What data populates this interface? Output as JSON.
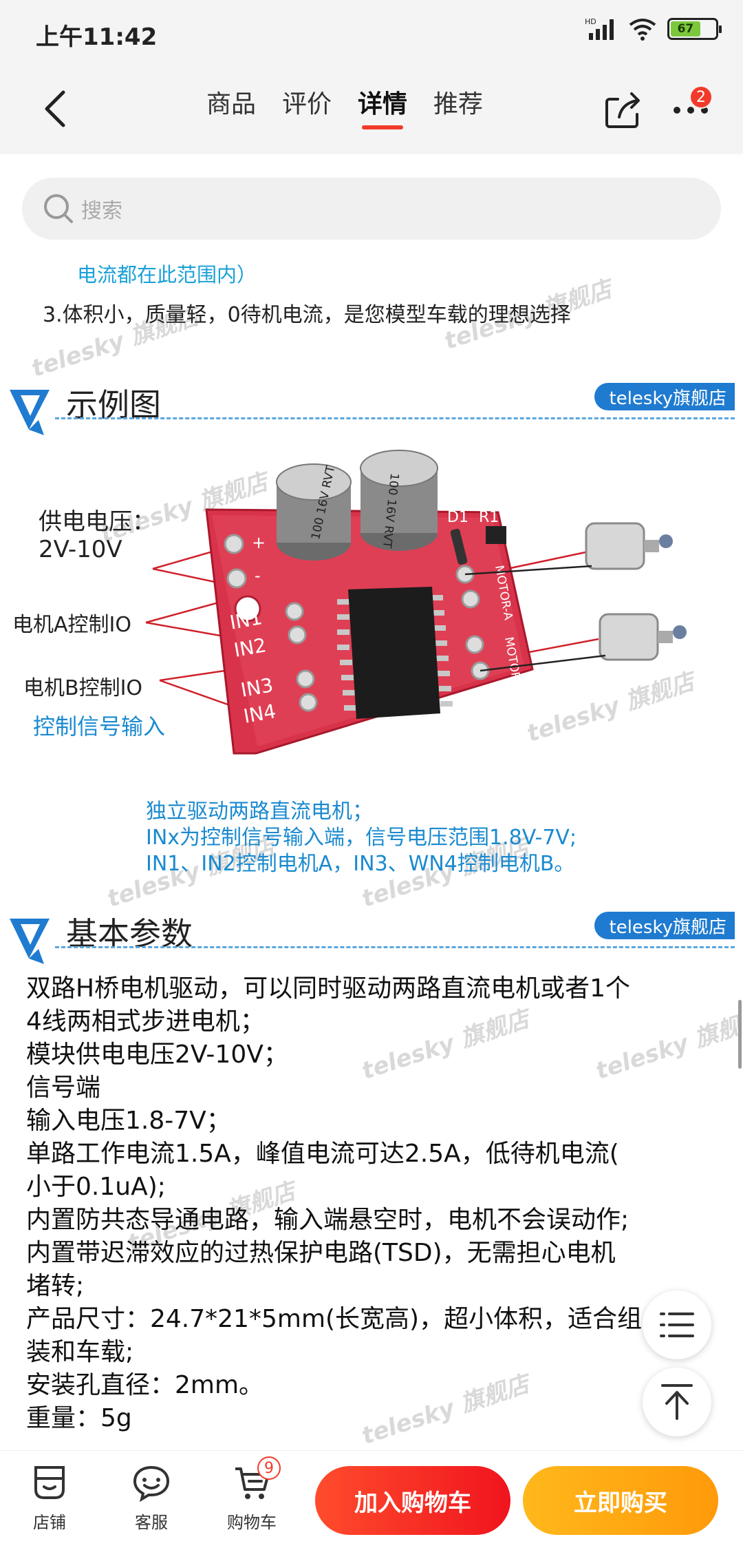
{
  "status_bar": {
    "time": "上午11:42",
    "network": "HD",
    "battery": "67"
  },
  "nav": {
    "tabs": [
      "商品",
      "评价",
      "详情",
      "推荐"
    ],
    "active_tab": "详情",
    "more_badge": "2"
  },
  "search": {
    "placeholder": "搜索"
  },
  "detail": {
    "intro_tail": "电流都在此范围内）",
    "feature_3": "3.体积小，质量轻，0待机电流，是您模型车载的理想选择",
    "watermark": "telesky 旗舰店",
    "section_example": {
      "title": "示例图",
      "brand_tag": "telesky旗舰店"
    },
    "pcb_labels": {
      "power_label": "供电电压：",
      "power_range": "2V-10V",
      "motor_a_io": "电机A控制IO",
      "motor_b_io": "电机B控制IO",
      "signal_input": "控制信号输入"
    },
    "pcb_silkscreen": {
      "cap1": "100 16V RVT",
      "cap2": "100 16V RVT",
      "d1": "D1",
      "r1": "R1",
      "in1": "IN1",
      "in2": "IN2",
      "in3": "IN3",
      "in4": "IN4",
      "motor_a": "MOTOR-A",
      "motor_b": "MOTOR-B",
      "plus": "+",
      "minus": "-"
    },
    "desc_lines": [
      "独立驱动两路直流电机；",
      "INx为控制信号输入端，信号电压范围1.8V-7V;",
      "IN1、IN2控制电机A，IN3、WN4控制电机B。"
    ],
    "section_params": {
      "title": "基本参数",
      "brand_tag": "telesky旗舰店"
    },
    "params_lines": [
      "双路H桥电机驱动，可以同时驱动两路直流电机或者1个",
      "4线两相式步进电机；",
      "模块供电电压2V-10V；",
      "信号端",
      "输入电压1.8-7V；",
      "单路工作电流1.5A，峰值电流可达2.5A，低待机电流(",
      "小于0.1uA);",
      "内置防共态导通电路，输入端悬空时，电机不会误动作;",
      "内置带迟滞效应的过热保护电路(TSD)，无需担心电机",
      "堵转;",
      "产品尺寸：24.7*21*5mm(长宽高)，超小体积，适合组",
      "装和车载;",
      "安装孔直径：2mm。",
      "重量：5g"
    ]
  },
  "bottom_bar": {
    "store": "店铺",
    "service": "客服",
    "cart": "购物车",
    "cart_badge": "9",
    "add_to_cart": "加入购物车",
    "buy_now": "立即购买"
  },
  "colors": {
    "accent_red": "#f23a2a",
    "buy_orange": "#ffa516",
    "info_blue": "#1a8ad0",
    "pcb_red": "#d8334a"
  }
}
